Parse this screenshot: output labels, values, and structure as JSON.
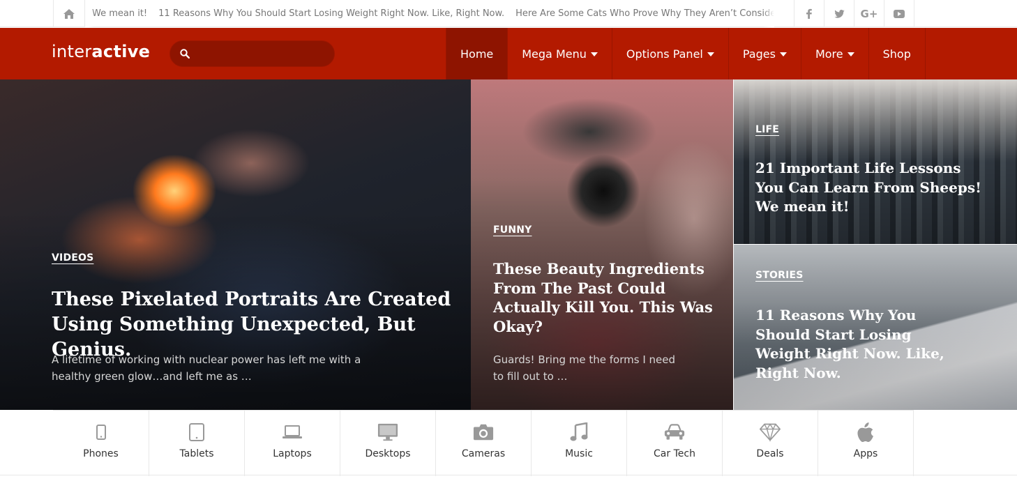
{
  "colors": {
    "brand": "#b31a00",
    "brand_dark": "#8e1400",
    "icon_gray": "#999999"
  },
  "topbar": {
    "home_icon": "home-icon",
    "ticker": [
      "We mean it!",
      "11 Reasons Why You Should Start Losing Weight Right Now. Like, Right Now.",
      "Here Are Some Cats Who Prove Why They Aren’t Considered I"
    ],
    "socials": [
      "facebook-icon",
      "twitter-icon",
      "google-plus-icon",
      "youtube-icon"
    ]
  },
  "header": {
    "logo_light": "inter",
    "logo_bold": "active",
    "search": {
      "placeholder": "",
      "value": ""
    },
    "nav": [
      {
        "label": "Home",
        "active": true,
        "has_dropdown": false
      },
      {
        "label": "Mega Menu",
        "active": false,
        "has_dropdown": true
      },
      {
        "label": "Options Panel",
        "active": false,
        "has_dropdown": true
      },
      {
        "label": "Pages",
        "active": false,
        "has_dropdown": true
      },
      {
        "label": "More",
        "active": false,
        "has_dropdown": true
      },
      {
        "label": "Shop",
        "active": false,
        "has_dropdown": false
      }
    ]
  },
  "hero": {
    "main": {
      "category": "VIDEOS",
      "title": "These Pixelated Portraits Are Created Using Something Unexpected, But Genius.",
      "excerpt": "A lifetime of working with nuclear power has left me with a healthy green glow…and left me as …"
    },
    "middle": {
      "category": "FUNNY",
      "title": "These Beauty Ingredients From The Past Could Actually Kill You. This Was Okay?",
      "excerpt": "Guards! Bring me the forms I need to fill out to …"
    },
    "top_right": {
      "category": "LIFE",
      "title": "21 Important Life Lessons You Can Learn From Sheeps! We mean it!"
    },
    "bottom_right": {
      "category": "STORIES",
      "title": "11 Reasons Why You Should Start Losing Weight Right Now. Like, Right Now."
    }
  },
  "categories": [
    {
      "label": "Phones",
      "icon": "phone-icon"
    },
    {
      "label": "Tablets",
      "icon": "tablet-icon"
    },
    {
      "label": "Laptops",
      "icon": "laptop-icon"
    },
    {
      "label": "Desktops",
      "icon": "desktop-icon"
    },
    {
      "label": "Cameras",
      "icon": "camera-icon"
    },
    {
      "label": "Music",
      "icon": "music-icon"
    },
    {
      "label": "Car Tech",
      "icon": "car-icon"
    },
    {
      "label": "Deals",
      "icon": "diamond-icon"
    },
    {
      "label": "Apps",
      "icon": "apple-icon"
    }
  ]
}
